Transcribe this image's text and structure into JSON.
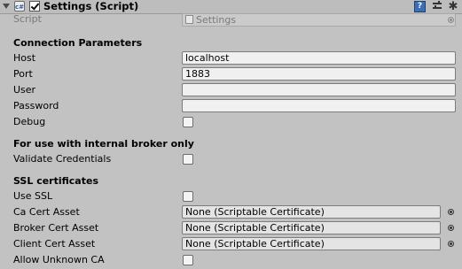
{
  "component": {
    "title": "Settings (Script)",
    "script_icon_text": "c#",
    "enabled": true,
    "help_icon_text": "?",
    "gear_icon_glyph": "✱"
  },
  "script_row": {
    "label": "Script",
    "value": "Settings"
  },
  "connection": {
    "heading": "Connection Parameters",
    "host": {
      "label": "Host",
      "value": "localhost"
    },
    "port": {
      "label": "Port",
      "value": "1883"
    },
    "user": {
      "label": "User",
      "value": ""
    },
    "password": {
      "label": "Password",
      "value": ""
    },
    "debug": {
      "label": "Debug",
      "checked": false
    }
  },
  "broker": {
    "heading": "For use with internal broker only",
    "validate_credentials": {
      "label": "Validate Credentials",
      "checked": false
    }
  },
  "ssl": {
    "heading": "SSL certificates",
    "use_ssl": {
      "label": "Use SSL",
      "checked": false
    },
    "ca_cert": {
      "label": "Ca Cert Asset",
      "value": "None (Scriptable Certificate)"
    },
    "broker_cert": {
      "label": "Broker Cert Asset",
      "value": "None (Scriptable Certificate)"
    },
    "client_cert": {
      "label": "Client Cert Asset",
      "value": "None (Scriptable Certificate)"
    },
    "allow_unknown_ca": {
      "label": "Allow Unknown CA",
      "checked": false
    }
  },
  "colors": {
    "inspector_bg": "#c2c2c2",
    "field_bg": "#f0f0f0",
    "help_icon_blue": "#3b6fb6"
  }
}
